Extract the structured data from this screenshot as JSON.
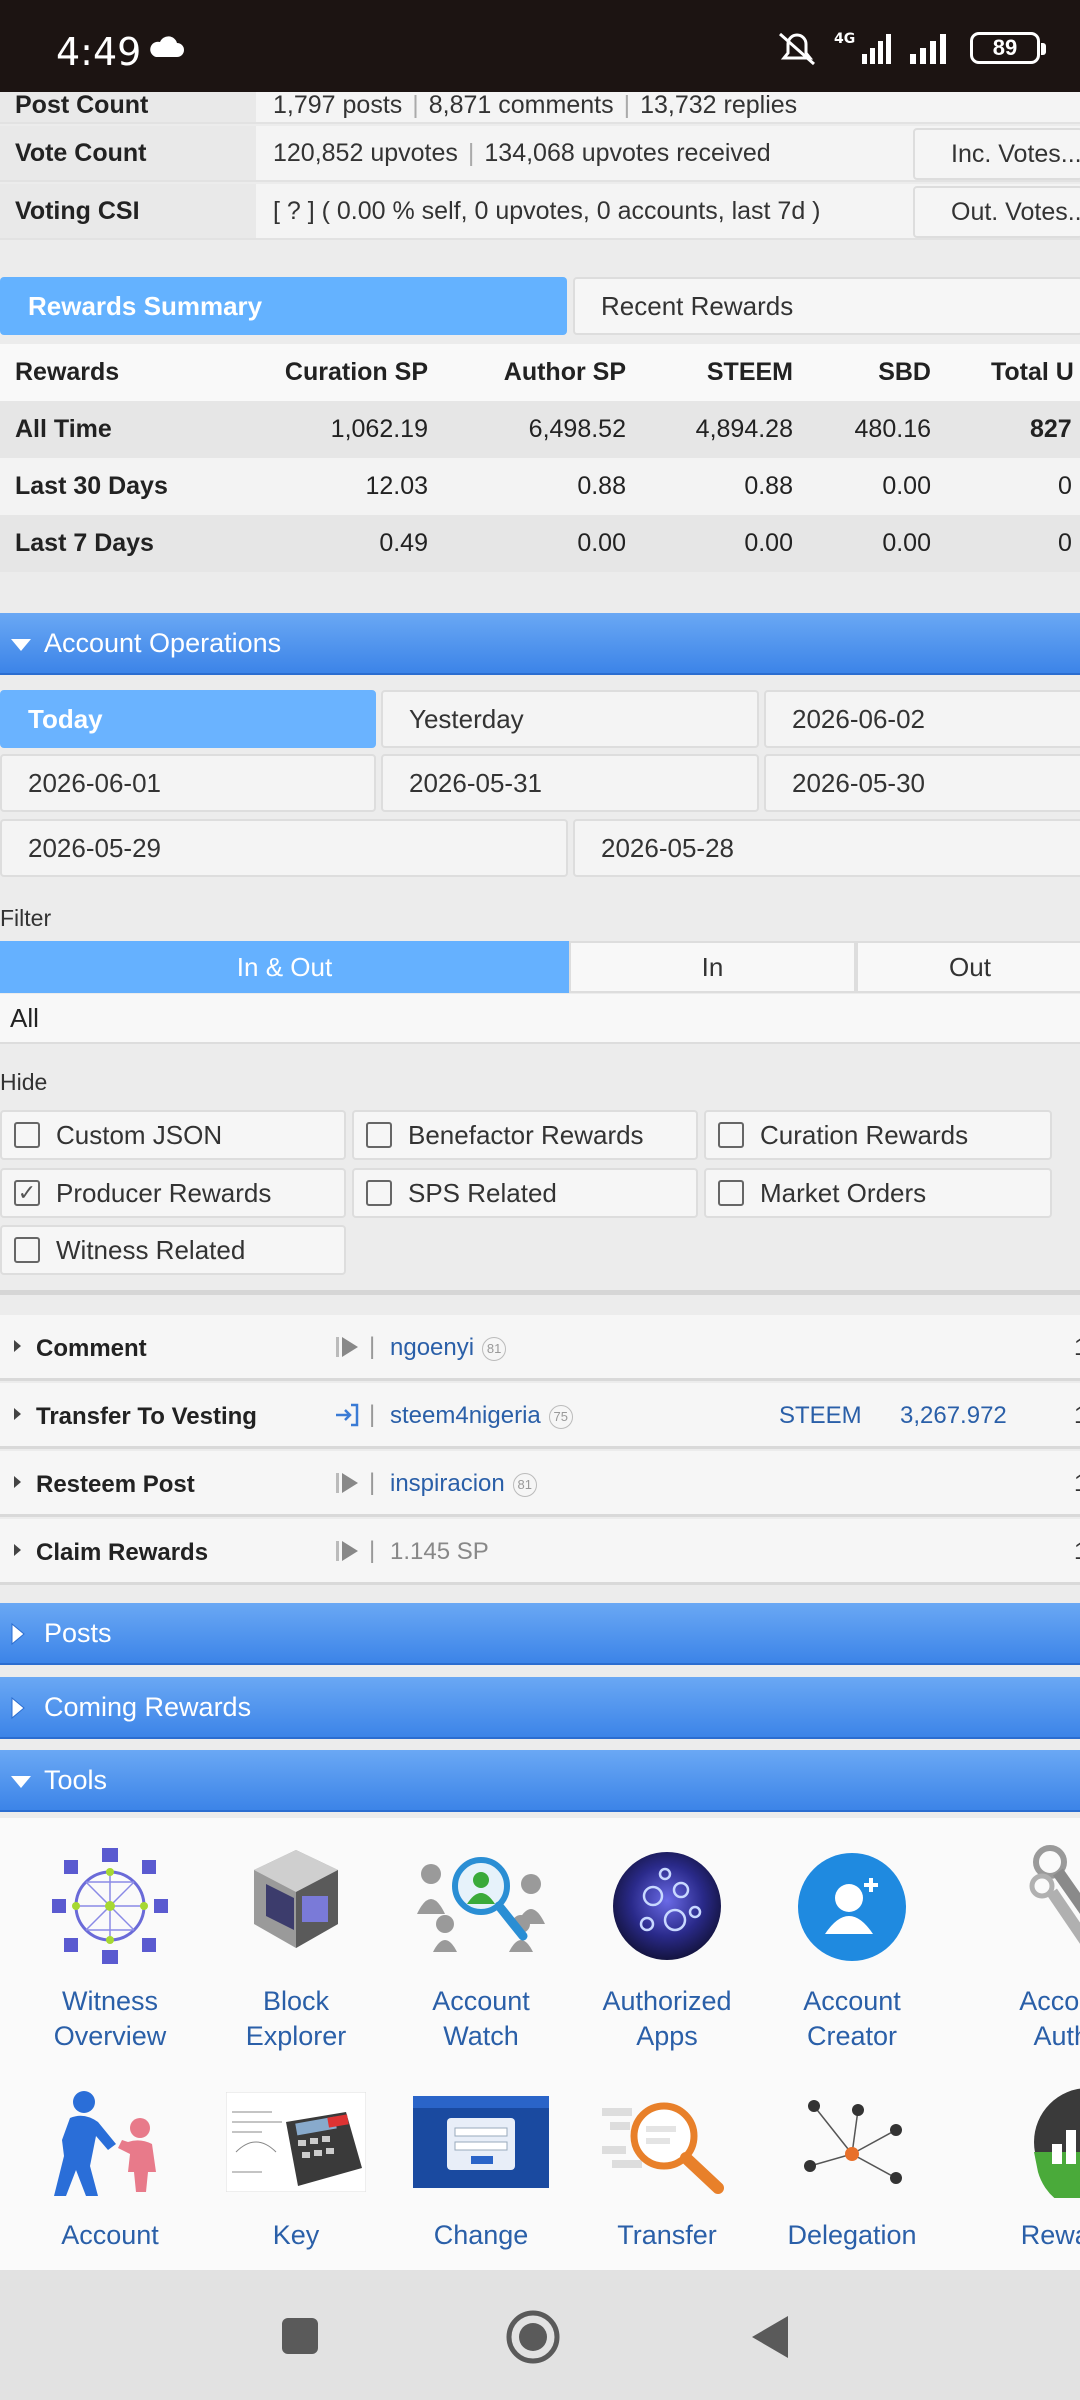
{
  "status_bar": {
    "time": "4:49",
    "battery": "89",
    "network": "4G"
  },
  "account_info": {
    "post_count_label": "Post Count",
    "post_count_posts": "1,797 posts",
    "post_count_comments": "8,871 comments",
    "post_count_replies": "13,732 replies",
    "vote_count_label": "Vote Count",
    "vote_count_upvotes": "120,852 upvotes",
    "vote_count_received": "134,068 upvotes received",
    "inc_votes_button": "Inc. Votes...",
    "voting_csi_label": "Voting CSI",
    "voting_csi_value": "[ ? ] ( 0.00 % self, 0 upvotes, 0 accounts, last 7d )",
    "out_votes_button": "Out. Votes..."
  },
  "rewards_tabs": {
    "summary": "Rewards Summary",
    "recent": "Recent Rewards"
  },
  "rewards_table": {
    "headers": [
      "Rewards",
      "Curation SP",
      "Author SP",
      "STEEM",
      "SBD",
      "Total U"
    ],
    "rows": [
      [
        "All Time",
        "1,062.19",
        "6,498.52",
        "4,894.28",
        "480.16",
        "827"
      ],
      [
        "Last 30 Days",
        "12.03",
        "0.88",
        "0.88",
        "0.00",
        "0"
      ],
      [
        "Last 7 Days",
        "0.49",
        "0.00",
        "0.00",
        "0.00",
        "0"
      ]
    ]
  },
  "account_operations": {
    "title": "Account Operations",
    "dates": [
      "Today",
      "Yesterday",
      "2026-06-02",
      "2026-06-01",
      "2026-05-31",
      "2026-05-30",
      "2026-05-29",
      "2026-05-28"
    ],
    "filter_label": "Filter",
    "filter_options": [
      "In & Out",
      "In",
      "Out"
    ],
    "filter_select": "All",
    "hide_label": "Hide",
    "hide_options": [
      "Custom JSON",
      "Benefactor Rewards",
      "Curation Rewards",
      "Producer Rewards",
      "SPS Related",
      "Market Orders",
      "Witness Related"
    ],
    "hide_checked": "Producer Rewards",
    "operations": [
      {
        "name": "Comment",
        "who": "ngoenyi",
        "rep": "81",
        "tail": "1"
      },
      {
        "name": "Transfer To Vesting",
        "who": "steem4nigeria",
        "rep": "75",
        "asset": "STEEM",
        "amount": "3,267.972",
        "tail": "1"
      },
      {
        "name": "Resteem Post",
        "who": "inspiracion",
        "rep": "81",
        "tail": "1"
      },
      {
        "name": "Claim Rewards",
        "plain": "1.145 SP",
        "tail": "1"
      }
    ]
  },
  "sections": {
    "posts": "Posts",
    "coming_rewards": "Coming Rewards",
    "tools": "Tools"
  },
  "tools": {
    "row1": [
      {
        "line1": "Witness",
        "line2": "Overview"
      },
      {
        "line1": "Block",
        "line2": "Explorer"
      },
      {
        "line1": "Account",
        "line2": "Watch"
      },
      {
        "line1": "Authorized",
        "line2": "Apps"
      },
      {
        "line1": "Account",
        "line2": "Creator"
      },
      {
        "line1": "Account",
        "line2": "Auths"
      }
    ],
    "row2": [
      {
        "line1": "Account"
      },
      {
        "line1": "Key"
      },
      {
        "line1": "Change"
      },
      {
        "line1": "Transfer"
      },
      {
        "line1": "Delegation"
      },
      {
        "line1": "Rewards"
      }
    ]
  },
  "colors": {
    "accent_blue": "#65b1ff",
    "section_blue": "#3c84e8",
    "link_blue": "#2a5fa8"
  }
}
